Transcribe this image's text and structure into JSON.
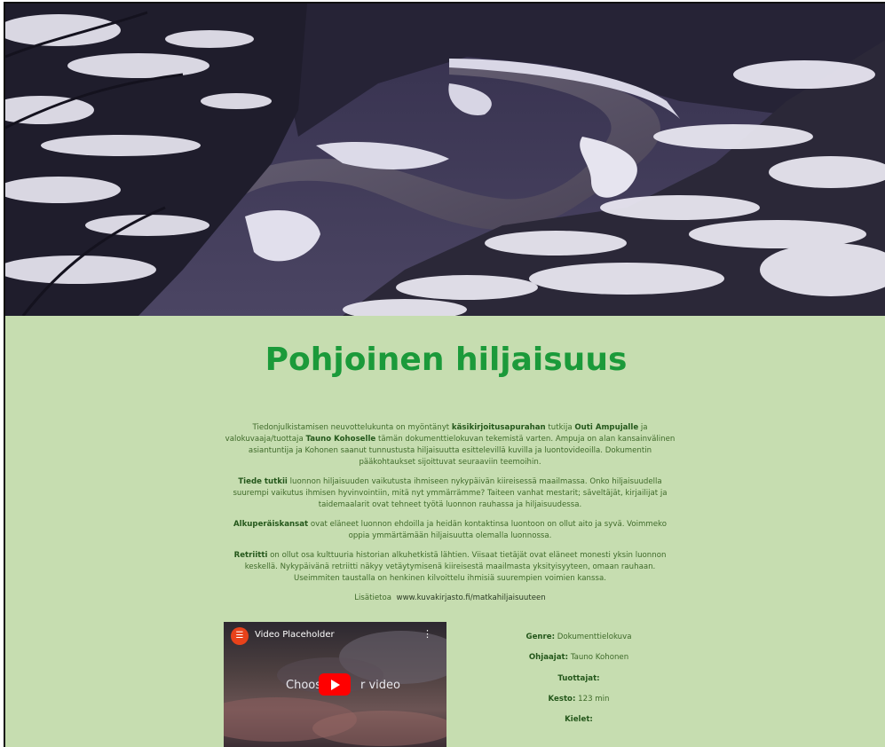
{
  "page": {
    "title": "Pohjoinen hiljaisuus"
  },
  "intro": {
    "t1": "Tiedonjulkistamisen neuvottelukunta on myöntänyt ",
    "b1": "käsikirjoitusapurahan",
    "t2": " tutkija ",
    "b2": "Outi Ampujalle",
    "t3": " ja valokuvaaja/tuottaja ",
    "b3": "Tauno Kohoselle",
    "t4": " tämän dokumenttielokuvan tekemistä varten. Ampuja on alan kansainvälinen asiantuntija ja Kohonen saanut tunnustusta hiljaisuutta esittelevillä kuvilla ja luontovideoilla. Dokumentin pääkohtaukset sijoittuvat seuraaviin teemoihin."
  },
  "theme1": {
    "bold": "Tiede tutkii",
    "text": " luonnon hiljaisuuden vaikutusta ihmiseen nykypäivän kiireisessä maailmassa. Onko hiljaisuudella suurempi vaikutus ihmisen hyvinvointiin, mitä nyt ymmärrämme? Taiteen vanhat mestarit; säveltäjät, kirjailijat ja taidemaalarit ovat tehneet työtä luonnon rauhassa ja hiljaisuudessa."
  },
  "theme2": {
    "bold": "Alkuperäiskansat",
    "text": " ovat eläneet luonnon ehdoilla ja heidän kontaktinsa luontoon on ollut aito ja syvä. Voimmeko oppia ymmärtämään hiljaisuutta olemalla luonnossa."
  },
  "theme3": {
    "bold": "Retriitti",
    "text": " on ollut osa kulttuuria historian alkuhetkistä lähtien. Viisaat tietäjät ovat eläneet monesti yksin luonnon keskellä. Nykypäivänä retriitti näkyy vetäytymisenä kiireisestä maailmasta yksityisyyteen, omaan rauhaan. Useimmiten taustalla on henkinen kilvoittelu ihmisiä suurempien voimien kanssa."
  },
  "more": {
    "label": "Lisätietoa",
    "url": "www.kuvakirjasto.fi/matkahiljaisuuteen"
  },
  "video": {
    "title": "Video Placeholder",
    "prompt_left": "Choos",
    "prompt_right": "r video",
    "logo_icon": "elementor-logo-icon",
    "menu_icon": "kebab-menu-icon",
    "play_icon": "youtube-play-icon"
  },
  "meta": {
    "genre_label": "Genre:",
    "genre_value": " Dokumenttielokuva",
    "directors_label": "Ohjaajat:",
    "directors_value": " Tauno Kohonen",
    "producers_label": "Tuottajat:",
    "duration_label": "Kesto:",
    "duration_value": " 123 min",
    "languages_label": "Kielet:"
  },
  "colors": {
    "background": "#c6ddb0",
    "title": "#1b9a3a",
    "text": "#3f6a2a",
    "play_button": "#ff0000"
  }
}
